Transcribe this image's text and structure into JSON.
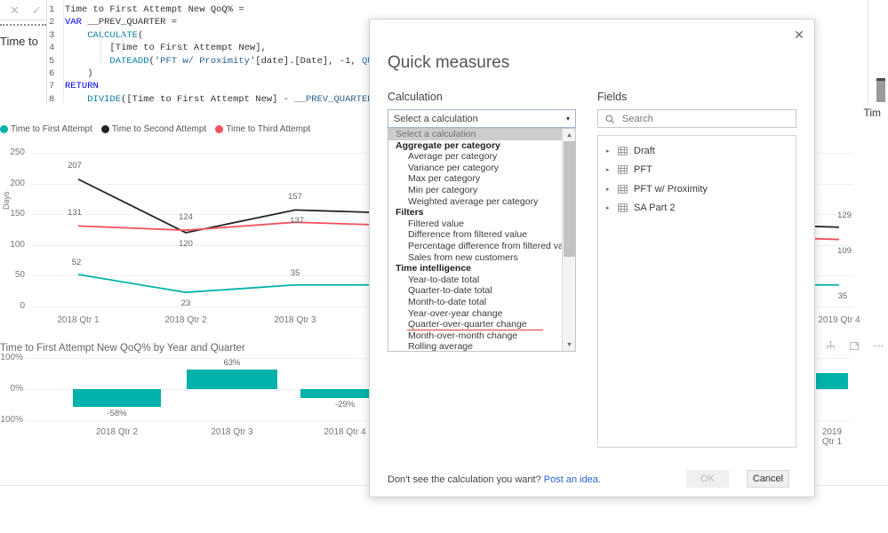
{
  "formula_bar": {
    "cancel_icon": "close-icon",
    "accept_icon": "checkmark-icon",
    "left_label": "Time to",
    "code_lines": [
      {
        "n": "1",
        "segments": [
          {
            "t": "Time to First Attempt New QoQ% =",
            "c": "k-num"
          }
        ]
      },
      {
        "n": "2",
        "segments": [
          {
            "t": "VAR ",
            "c": "k-blue"
          },
          {
            "t": "__PREV_QUARTER =",
            "c": "k-num"
          }
        ]
      },
      {
        "n": "3",
        "segments": [
          {
            "t": "    ",
            "c": "k-num"
          },
          {
            "t": "CALCULATE",
            "c": "k-func"
          },
          {
            "t": "(",
            "c": "k-num"
          }
        ]
      },
      {
        "n": "4",
        "segments": [
          {
            "t": "        [Time to First Attempt New],",
            "c": "k-num"
          }
        ]
      },
      {
        "n": "5",
        "segments": [
          {
            "t": "        ",
            "c": "k-num"
          },
          {
            "t": "DATEADD",
            "c": "k-func"
          },
          {
            "t": "(",
            "c": "k-num"
          },
          {
            "t": "'PFT w/ Proximity'",
            "c": "k-id"
          },
          {
            "t": "[date].[Date], -1, ",
            "c": "k-num"
          },
          {
            "t": "QUARTER",
            "c": "k-fn2"
          },
          {
            "t": ")",
            "c": "k-num"
          }
        ]
      },
      {
        "n": "6",
        "segments": [
          {
            "t": "    )",
            "c": "k-num"
          }
        ]
      },
      {
        "n": "7",
        "segments": [
          {
            "t": "RETURN",
            "c": "k-blue"
          }
        ]
      },
      {
        "n": "8",
        "segments": [
          {
            "t": "    ",
            "c": "k-num"
          },
          {
            "t": "DIVIDE",
            "c": "k-func"
          },
          {
            "t": "(",
            "c": "k-num"
          },
          {
            "t": "[Time to First Attempt New] - ",
            "c": "k-num"
          },
          {
            "t": "__PREV_QUARTER, __PREV_QUARTER",
            "c": "k-id"
          },
          {
            "t": ")",
            "c": "k-num"
          }
        ]
      }
    ]
  },
  "line_visual": {
    "title": "Tim",
    "y_axis_label": "Days",
    "legend": [
      {
        "label": "Time to First Attempt",
        "color": "#00b2a9"
      },
      {
        "label": "Time to Second Attempt",
        "color": "#252423"
      },
      {
        "label": "Time to Third Attempt",
        "color": "#f2525d"
      }
    ]
  },
  "bar_visual": {
    "title": "Time to First Attempt New QoQ% by Year and Quarter",
    "header_icons": [
      "sort-icon",
      "hierarchy-icon",
      "focus-mode-icon",
      "more-options-icon"
    ]
  },
  "chart_data": [
    {
      "type": "line",
      "title": "Tim",
      "xlabel": "",
      "ylabel": "Days",
      "ylim": [
        0,
        250
      ],
      "yticks": [
        0,
        50,
        100,
        150,
        200,
        250
      ],
      "grid": true,
      "legend_position": "top-left",
      "categories": [
        "2018 Qtr 1",
        "2018 Qtr 2",
        "2018 Qtr 3",
        "2019 Qtr 4"
      ],
      "series": [
        {
          "name": "Time to First Attempt",
          "color": "#00b2a9",
          "values": [
            52,
            23,
            35,
            35
          ],
          "labels": [
            "52",
            "23",
            "35",
            "35"
          ]
        },
        {
          "name": "Time to Second Attempt",
          "color": "#252423",
          "values": [
            207,
            120,
            157,
            129
          ],
          "labels": [
            "207",
            "120",
            "157",
            "129"
          ]
        },
        {
          "name": "Time to Third Attempt",
          "color": "#f2525d",
          "values": [
            131,
            124,
            137,
            109
          ],
          "labels": [
            "131",
            "124",
            "137",
            "109"
          ]
        }
      ]
    },
    {
      "type": "bar",
      "title": "Time to First Attempt New QoQ% by Year and Quarter",
      "xlabel": "",
      "ylabel": "",
      "ylim": [
        -100,
        100
      ],
      "yticks": [
        "100%",
        "0%",
        "-100%"
      ],
      "grid": true,
      "categories": [
        "2018 Qtr 2",
        "2018 Qtr 3",
        "2018 Qtr 4",
        "2019 Qtr 1"
      ],
      "values": [
        -58,
        63,
        -29,
        52
      ],
      "labels": [
        "-58%",
        "63%",
        "-29%",
        ""
      ],
      "bar_color": "#00b2a9"
    }
  ],
  "modal": {
    "title": "Quick measures",
    "close_icon": "close-icon",
    "calculation_label": "Calculation",
    "fields_label": "Fields",
    "select_value": "Select a calculation",
    "select_caret": "▾",
    "options": [
      {
        "label": "Select a calculation",
        "kind": "placeholder"
      },
      {
        "label": "Aggregate per category",
        "kind": "group"
      },
      {
        "label": "Average per category",
        "kind": "item"
      },
      {
        "label": "Variance per category",
        "kind": "item"
      },
      {
        "label": "Max per category",
        "kind": "item"
      },
      {
        "label": "Min per category",
        "kind": "item"
      },
      {
        "label": "Weighted average per category",
        "kind": "item"
      },
      {
        "label": "Filters",
        "kind": "group"
      },
      {
        "label": "Filtered value",
        "kind": "item"
      },
      {
        "label": "Difference from filtered value",
        "kind": "item"
      },
      {
        "label": "Percentage difference from filtered value",
        "kind": "item"
      },
      {
        "label": "Sales from new customers",
        "kind": "item"
      },
      {
        "label": "Time intelligence",
        "kind": "group"
      },
      {
        "label": "Year-to-date total",
        "kind": "item"
      },
      {
        "label": "Quarter-to-date total",
        "kind": "item"
      },
      {
        "label": "Month-to-date total",
        "kind": "item"
      },
      {
        "label": "Year-over-year change",
        "kind": "item"
      },
      {
        "label": "Quarter-over-quarter change",
        "kind": "item-annotated"
      },
      {
        "label": "Month-over-month change",
        "kind": "item"
      },
      {
        "label": "Rolling average",
        "kind": "item"
      }
    ],
    "search_placeholder": "Search",
    "search_value": "",
    "search_icon": "search-icon",
    "fields": [
      {
        "label": "Draft",
        "icon": "table-icon",
        "expanded": false
      },
      {
        "label": "PFT",
        "icon": "table-icon",
        "expanded": false
      },
      {
        "label": "PFT w/ Proximity",
        "icon": "table-icon",
        "expanded": false
      },
      {
        "label": "SA Part 2",
        "icon": "table-icon",
        "expanded": false
      }
    ],
    "footer_text": "Don't see the calculation you want? ",
    "footer_link": "Post an idea.",
    "ok_label": "OK",
    "cancel_label": "Cancel",
    "annotation_color": "#d93b3b"
  }
}
